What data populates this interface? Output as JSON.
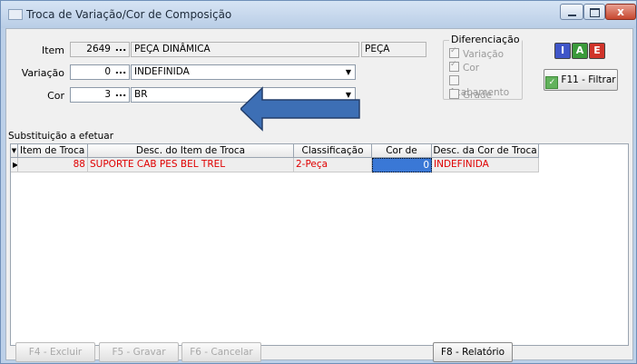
{
  "window": {
    "title": "Troca de Variação/Cor de Composição",
    "close_glyph": "x"
  },
  "form": {
    "item_label": "Item",
    "item_code": "2649",
    "item_desc": "PEÇA DINÂMICA",
    "item_type": "PEÇA",
    "variacao_label": "Variação",
    "variacao_code": "0",
    "variacao_desc": "INDEFINIDA",
    "cor_label": "Cor",
    "cor_code": "3",
    "cor_desc": "BR",
    "lookup_glyph": "..."
  },
  "diferenciacao": {
    "title": "Diferenciação",
    "options": [
      {
        "label": "Variação",
        "checked": true
      },
      {
        "label": "Cor",
        "checked": true
      },
      {
        "label": "Acabamento",
        "checked": false
      },
      {
        "label": "Grade",
        "checked": false
      }
    ]
  },
  "toolbar": {
    "btn_i": "I",
    "btn_a": "A",
    "btn_e": "E",
    "filter_label": "F11 - Filtrar"
  },
  "section": {
    "title": "Substituição a efetuar"
  },
  "table": {
    "columns": [
      "Item de Troca",
      "Desc. do Item de Troca",
      "Classificação",
      "Cor de Troca",
      "Desc. da Cor de Troca"
    ],
    "rows": [
      {
        "item": "88",
        "desc": "SUPORTE CAB PES BEL TREL",
        "classificacao": "2-Peça",
        "cor": "0",
        "desc_cor": "INDEFINIDA"
      }
    ]
  },
  "footer": {
    "excluir": "F4 - Excluir",
    "gravar": "F5 - Gravar",
    "cancelar": "F6 - Cancelar",
    "relatorio": "F8 - Relatório"
  },
  "colors": {
    "annotation_arrow": "#3d6fb5",
    "row_text": "#e00000",
    "selected_cell": "#3a78d6"
  }
}
